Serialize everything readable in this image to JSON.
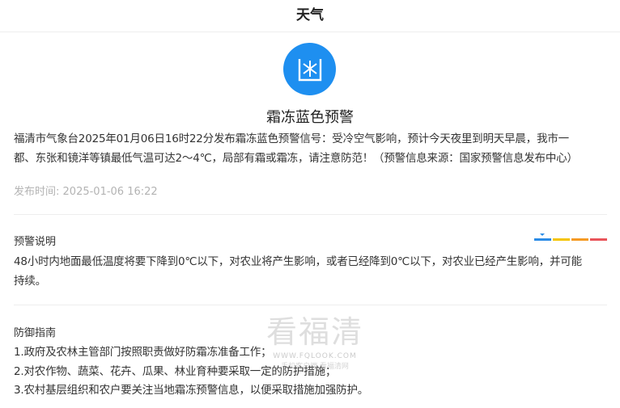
{
  "header": {
    "title": "天气"
  },
  "alert": {
    "icon": "frost-warning-icon",
    "color": "#1e8ff0",
    "title": "霜冻蓝色预警",
    "text_line1": "福清市气象台2025年01月06日16时22分发布霜冻蓝色预警信号：受冷空气影响，预计今天夜里到明天早晨，我市一",
    "text_line2": "都、东张和镜洋等镇最低气温可达2～4℃，局部有霜或霜冻，请注意防范！（预警信息来源：国家预警信息发布中心）",
    "publish_label": "发布时间:",
    "publish_time": "2025-01-06 16:22"
  },
  "levels": {
    "current": "blue",
    "colors": [
      "#2b8ce6",
      "#f5c400",
      "#f59a23",
      "#e9545a"
    ]
  },
  "description": {
    "title": "预警说明",
    "line1": "48小时内地面最低温度将要下降到0℃以下，对农业将产生影响，或者已经降到0℃以下，对农业已经产生影响，并可能",
    "line2": "持续。"
  },
  "guide": {
    "title": "防御指南",
    "items": [
      "1.政府及农林主管部门按照职责做好防霜冻准备工作；",
      "2.对农作物、蔬菜、花卉、瓜果、林业育种要采取一定的防护措施；",
      "3.农村基层组织和农户要关注当地霜冻预警信息，以便采取措施加强防护。"
    ]
  },
  "watermark": {
    "text": "看福清",
    "url": "WWW.FQLOOK.COM",
    "sub": "手机客户端 看福清网"
  }
}
